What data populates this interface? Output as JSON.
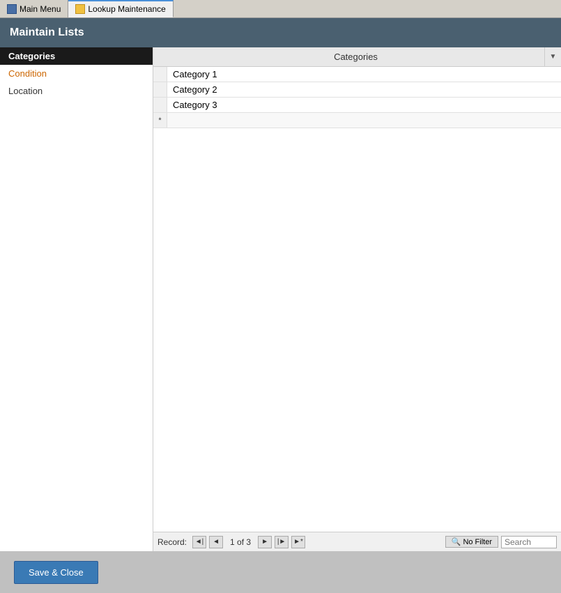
{
  "tabs": [
    {
      "id": "main-menu",
      "label": "Main Menu",
      "icon": "main-icon",
      "active": false
    },
    {
      "id": "lookup-maintenance",
      "label": "Lookup Maintenance",
      "icon": "lookup-icon",
      "active": true
    }
  ],
  "title": "Maintain Lists",
  "sidebar": {
    "items": [
      {
        "id": "categories",
        "label": "Categories",
        "selected": true,
        "style": "selected"
      },
      {
        "id": "condition",
        "label": "Condition",
        "selected": false,
        "style": "condition"
      },
      {
        "id": "location",
        "label": "Location",
        "selected": false,
        "style": "location"
      }
    ]
  },
  "grid": {
    "column_header": "Categories",
    "rows": [
      {
        "id": 1,
        "value": "Category 1"
      },
      {
        "id": 2,
        "value": "Category 2"
      },
      {
        "id": 3,
        "value": "Category 3"
      }
    ],
    "new_row_marker": "*"
  },
  "footer": {
    "record_label": "Record:",
    "current_record": "1",
    "total_records": "3",
    "record_display": "1 of 3",
    "no_filter_label": "No Filter",
    "search_placeholder": "Search"
  },
  "buttons": {
    "save_close": "Save & Close"
  },
  "nav": {
    "first": "◄",
    "prev": "◄",
    "next": "►",
    "last": "►",
    "last_new": "►*"
  }
}
